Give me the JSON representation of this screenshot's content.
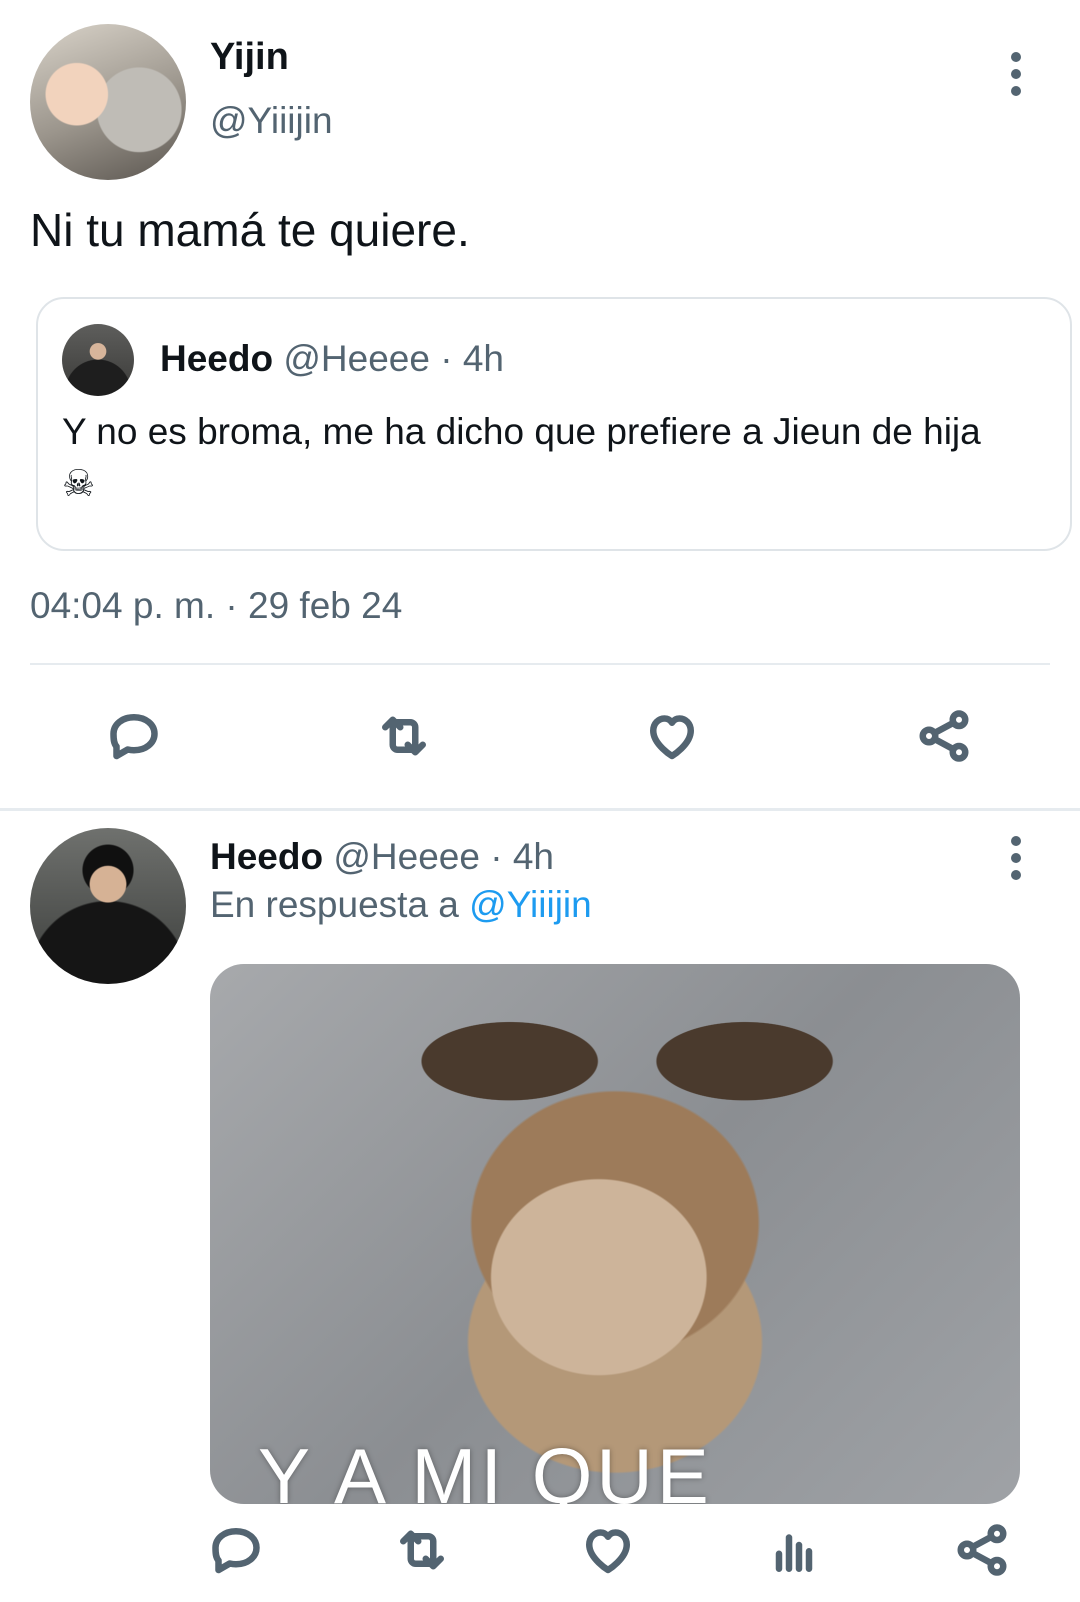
{
  "tweet": {
    "author_name": "Yijin",
    "author_handle": "@Yiiijin",
    "text": "Ni tu mamá te quiere.",
    "quoted": {
      "author_name": "Heedo",
      "author_handle": "@Heeee",
      "time": "· 4h",
      "text": "Y no es broma, me ha dicho que prefiere a Jieun de hija ☠"
    },
    "timestamp": "04:04 p. m. · 29 feb 24",
    "actions": [
      "reply-icon",
      "retweet-icon",
      "like-icon",
      "share-icon"
    ]
  },
  "reply": {
    "author_name": "Heedo",
    "author_handle": "@Heeee",
    "time": "· 4h",
    "replying_prefix": "En respuesta a",
    "replying_to": "@Yiiijin",
    "media_caption": "Y A MI QUE",
    "actions": [
      "reply-icon",
      "retweet-icon",
      "like-icon",
      "views-icon",
      "share-icon"
    ]
  },
  "colors": {
    "text": "#0f1419",
    "muted": "#536471",
    "link": "#1d9bf0",
    "border": "#dfe4e8"
  }
}
